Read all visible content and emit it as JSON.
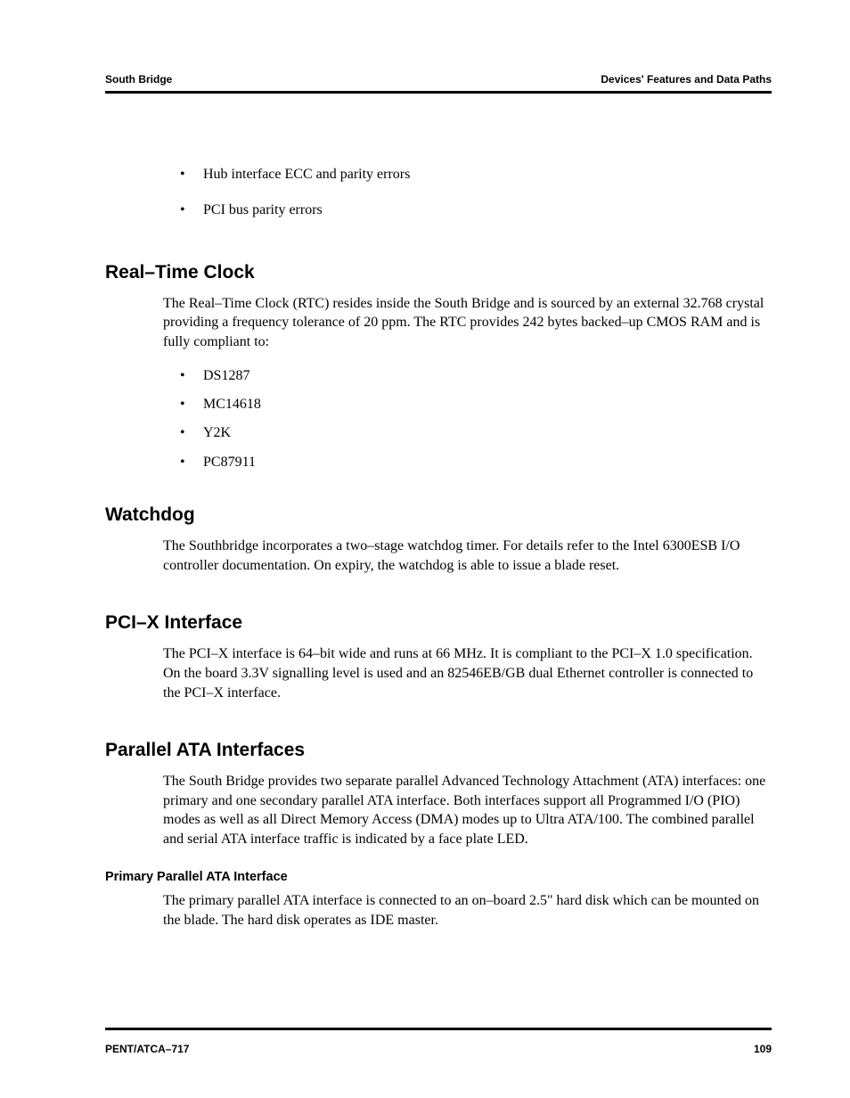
{
  "header": {
    "left": "South Bridge",
    "right": "Devices' Features and Data Paths"
  },
  "intro_bullets": [
    "Hub interface ECC and parity errors",
    "PCI bus parity errors"
  ],
  "sections": {
    "rtc": {
      "heading": "Real–Time Clock",
      "para": "The Real–Time Clock (RTC) resides inside the South Bridge and is sourced by an external 32.768 crystal providing a frequency tolerance of 20 ppm. The RTC provides 242 bytes backed–up CMOS RAM and is fully compliant to:",
      "items": [
        "DS1287",
        "MC14618",
        "Y2K",
        "PC87911"
      ]
    },
    "watchdog": {
      "heading": "Watchdog",
      "para": "The Southbridge incorporates a two–stage watchdog timer. For details refer to the Intel 6300ESB I/O controller documentation. On expiry, the watchdog is able to issue a blade reset."
    },
    "pcix": {
      "heading": "PCI–X Interface",
      "para": "The PCI–X interface is 64–bit wide and runs at 66 MHz. It is compliant to the PCI–X 1.0 specification. On the board 3.3V signalling level is used and an 82546EB/GB dual Ethernet controller is connected to the PCI–X interface."
    },
    "pata": {
      "heading": "Parallel ATA Interfaces",
      "para": "The South Bridge provides two separate parallel Advanced Technology Attachment (ATA) interfaces: one primary and one secondary parallel ATA interface. Both interfaces support all Programmed I/O (PIO) modes as well as all Direct Memory Access (DMA) modes up to Ultra ATA/100. The combined parallel and serial ATA interface traffic is indicated by a face plate LED.",
      "sub": {
        "heading": "Primary Parallel ATA Interface",
        "para": "The primary parallel ATA interface is connected to an on–board 2.5\" hard disk which can be mounted on the blade. The hard disk operates as IDE master."
      }
    }
  },
  "footer": {
    "left": "PENT/ATCA–717",
    "right": "109"
  }
}
